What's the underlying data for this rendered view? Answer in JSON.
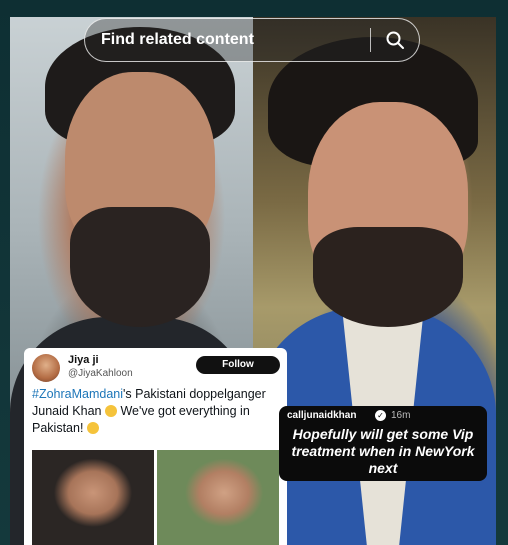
{
  "search": {
    "placeholder": "Find related content",
    "button_icon": "search-icon"
  },
  "tweet": {
    "name": "Jiya ji",
    "handle": "@JiyaKahloon",
    "follow_label": "Follow",
    "hashtag": "#ZohraMamdani",
    "text_part1": "'s Pakistani doppelganger Junaid Khan",
    "text_part2": " We've got everything in Pakistan!"
  },
  "story": {
    "username": "calljunaidkhan",
    "time": "16m",
    "caption": "Hopefully will get some Vip treatment when in NewYork next"
  },
  "colors": {
    "hashtag": "#1d76b8",
    "follow_bg": "#111111",
    "background": "#0f2a2f"
  }
}
